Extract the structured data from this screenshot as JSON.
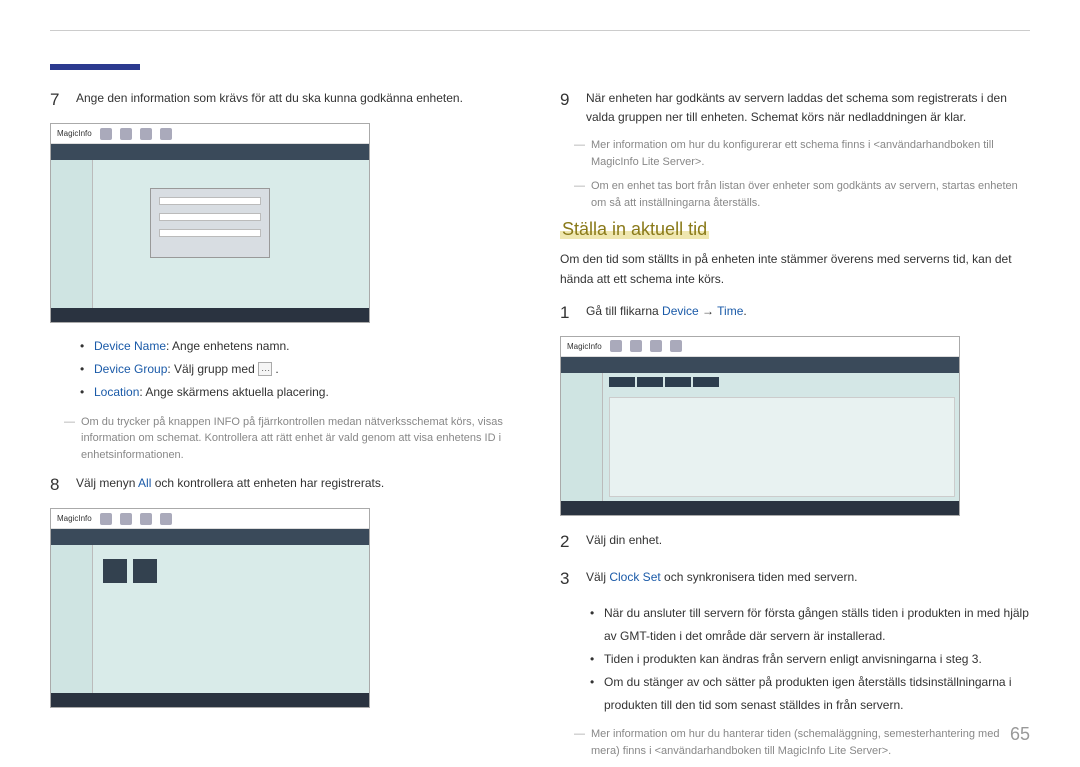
{
  "page_number": "65",
  "left": {
    "step7": "Ange den information som krävs för att du ska kunna godkänna enheten.",
    "bullet_devname_label": "Device Name",
    "bullet_devname_text": ": Ange enhetens namn.",
    "bullet_devgroup_label": "Device Group",
    "bullet_devgroup_text": ": Välj grupp med ",
    "bullet_location_label": "Location",
    "bullet_location_text": ": Ange skärmens aktuella placering.",
    "note_info": "Om du trycker på knappen INFO på fjärrkontrollen medan nätverksschemat körs, visas information om schemat. Kontrollera att rätt enhet är vald genom att visa enhetens ID i enhetsinformationen.",
    "step8_pre": "Välj menyn ",
    "step8_all": "All",
    "step8_post": " och kontrollera att enheten har registrerats."
  },
  "right": {
    "step9": "När enheten har godkänts av servern laddas det schema som registrerats i den valda gruppen ner till enheten. Schemat körs när nedladdningen är klar.",
    "note9a": "Mer information om hur du konfigurerar ett schema finns i <användarhandboken till MagicInfo Lite Server>.",
    "note9b": "Om en enhet tas bort från listan över enheter som godkänts av servern, startas enheten om så att inställningarna återställs.",
    "section_title": "Ställa in aktuell tid",
    "intro": "Om den tid som ställts in på enheten inte stämmer överens med serverns tid, kan det hända att ett schema inte körs.",
    "step1_pre": "Gå till flikarna ",
    "step1_device": "Device",
    "step1_arrow": " → ",
    "step1_time": "Time",
    "step1_post": ".",
    "step2": "Välj din enhet.",
    "step3_pre": "Välj ",
    "step3_clockset": "Clock Set",
    "step3_post": " och synkronisera tiden med servern.",
    "bullet_a": "När du ansluter till servern för första gången ställs tiden i produkten in med hjälp av GMT-tiden i det område där servern är installerad.",
    "bullet_b": "Tiden i produkten kan ändras från servern enligt anvisningarna i steg 3.",
    "bullet_c": "Om du stänger av och sätter på produkten igen återställs tidsinställningarna i produkten till den tid som senast ställdes in från servern.",
    "note_end": "Mer information om hur du hanterar tiden (schemaläggning, semesterhantering med mera) finns i <användarhandboken till MagicInfo Lite Server>."
  },
  "screenshot_logo": "MagicInfo"
}
